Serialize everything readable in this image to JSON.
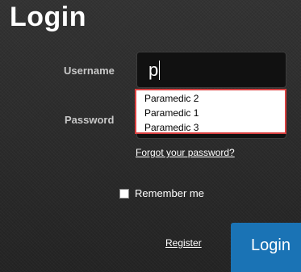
{
  "header": {
    "title": "Login"
  },
  "form": {
    "username_label": "Username",
    "username_value": "p",
    "password_label": "Password",
    "password_value": "",
    "autocomplete_options": [
      "Paramedic 2",
      "Paramedic 1",
      "Paramedic 3"
    ],
    "forgot_link": "Forgot your password?",
    "remember_label": "Remember me",
    "remember_checked": false,
    "register_link": "Register",
    "login_button": "Login"
  },
  "colors": {
    "background": "#2b2b2b",
    "login_button": "#1a73b5",
    "dropdown_border": "#d94040"
  }
}
